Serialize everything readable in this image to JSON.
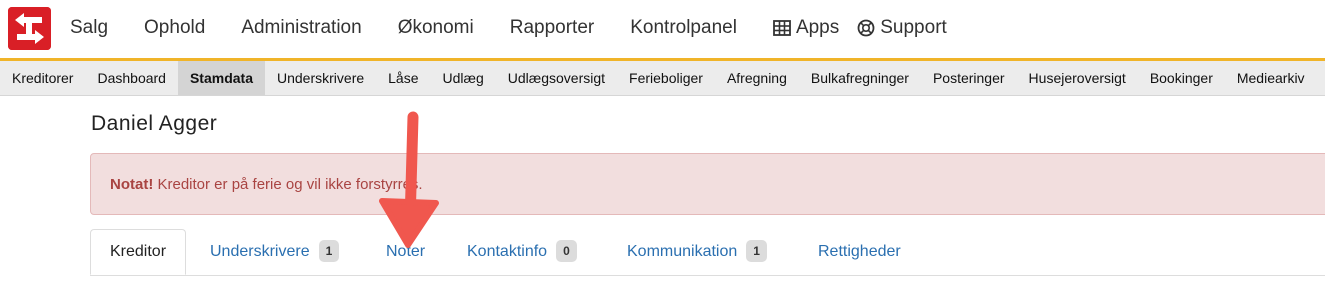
{
  "header": {
    "nav": [
      {
        "label": "Salg"
      },
      {
        "label": "Ophold"
      },
      {
        "label": "Administration"
      },
      {
        "label": "Økonomi"
      },
      {
        "label": "Rapporter"
      },
      {
        "label": "Kontrolpanel"
      },
      {
        "label": "Apps",
        "icon": "table-grid-icon"
      },
      {
        "label": "Support",
        "icon": "lifebuoy-icon"
      }
    ],
    "brand_color": "#d91f26",
    "accent_color": "#f0b429"
  },
  "subnav": {
    "items": [
      {
        "label": "Kreditorer"
      },
      {
        "label": "Dashboard"
      },
      {
        "label": "Stamdata",
        "active": true
      },
      {
        "label": "Underskrivere"
      },
      {
        "label": "Låse"
      },
      {
        "label": "Udlæg"
      },
      {
        "label": "Udlægsoversigt"
      },
      {
        "label": "Ferieboliger"
      },
      {
        "label": "Afregning"
      },
      {
        "label": "Bulkafregninger"
      },
      {
        "label": "Posteringer"
      },
      {
        "label": "Husejeroversigt"
      },
      {
        "label": "Bookinger"
      },
      {
        "label": "Mediearkiv"
      }
    ]
  },
  "page": {
    "title": "Daniel Agger"
  },
  "alert": {
    "strong": "Notat!",
    "text": " Kreditor er på ferie og vil ikke forstyrres."
  },
  "tabs": [
    {
      "label": "Kreditor",
      "active": true
    },
    {
      "label": "Underskrivere",
      "badge": "1"
    },
    {
      "label": "Noter"
    },
    {
      "label": "Kontaktinfo",
      "badge": "0"
    },
    {
      "label": "Kommunikation",
      "badge": "1"
    },
    {
      "label": "Rettigheder"
    }
  ],
  "annotation": {
    "arrow_color": "#f0574e"
  }
}
